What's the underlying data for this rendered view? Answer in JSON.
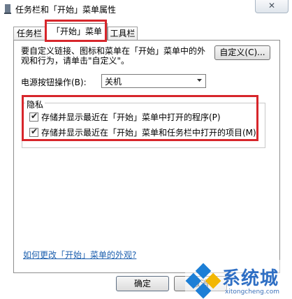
{
  "window": {
    "title": "任务栏和「开始」菜单属性",
    "close_glyph": "✕"
  },
  "tabs": [
    {
      "label": "任务栏"
    },
    {
      "label": "「开始」菜单"
    },
    {
      "label": "工具栏"
    }
  ],
  "start_tab": {
    "intro_text": "要自定义链接、图标和菜单在「开始」菜单中的外观和行为，请单击\"自定义\"。",
    "customize_label": "自定义(C)...",
    "power_label": "电源按钮操作(B):",
    "power_value": "关机",
    "privacy": {
      "title": "隐私",
      "items": [
        {
          "label": "存储并显示最近在「开始」菜单中打开的程序(P)",
          "checked": true
        },
        {
          "label": "存储并显示最近在「开始」菜单和任务栏中打开的项目(M)",
          "checked": true
        }
      ]
    },
    "help_link": "如何更改「开始」菜单的外观?"
  },
  "buttons": {
    "ok": "确定",
    "cancel": "取消"
  },
  "watermark": {
    "text": "系统城",
    "url": "xitongcheng.com"
  },
  "colors": {
    "highlight": "#d7262b",
    "link": "#1c5fae"
  }
}
